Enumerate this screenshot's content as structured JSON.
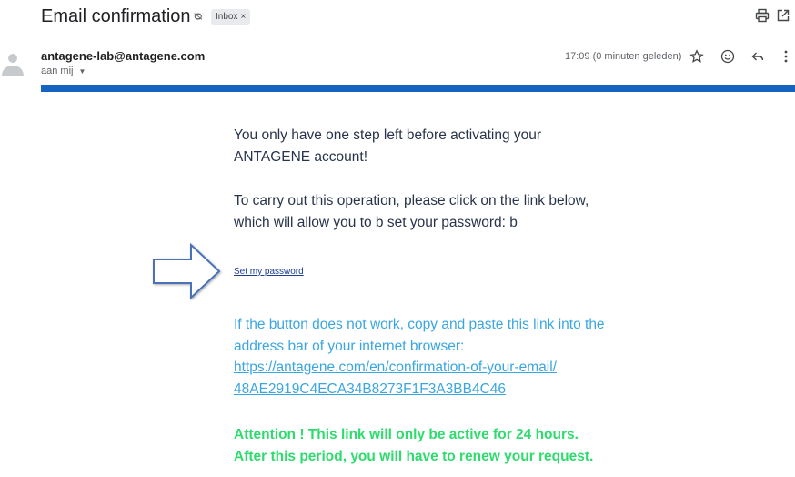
{
  "email": {
    "subject": "Email confirmation",
    "label": "Inbox",
    "label_close": "×",
    "sender": "antagene-lab@antagene.com",
    "recipient": "aan mij",
    "time": "17:09 (0 minuten geleden)"
  },
  "body": {
    "para1": "You only have one step left before activating your ANTAGENE account!",
    "para2": "To carry out this operation, please click on the link below, which will allow you to b set your password: b",
    "link_text": "Set my password",
    "para3_text": "If the button does not work, copy and paste this link into the address bar of your internet browser:",
    "url_line1": "https://antagene.com/en/confirmation-of-your-email/",
    "url_line2": "48AE2919C4ECA34B8273F1F3A3BB4C46",
    "attention_line1": "Attention ! This link will only be active for 24 hours.",
    "attention_line2": "After this period, you will have to renew your request."
  },
  "icons": {
    "importance": "importance-marker-icon",
    "print": "print-icon",
    "open_new": "open-in-new-window-icon",
    "star": "star-icon",
    "emoji": "emoji-icon",
    "reply": "reply-icon",
    "more": "more-vert-icon",
    "avatar": "avatar",
    "arrow": "arrow-right-icon"
  },
  "colors": {
    "accent_bar": "#1565c0",
    "body_text": "#27344a",
    "link_text": "#1a3d8f",
    "fallback_text": "#3aa6e0",
    "attention_text": "#2edc6e"
  }
}
